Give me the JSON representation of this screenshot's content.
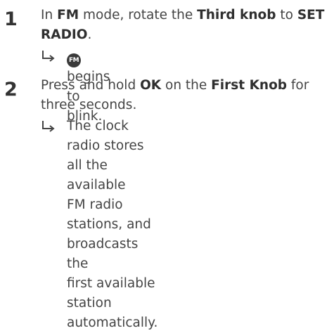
{
  "steps": [
    {
      "number": "1",
      "line1": {
        "a": "In ",
        "b": "FM",
        "c": " mode, rotate the ",
        "d": "Third knob",
        "e": " to ",
        "f": "SET"
      },
      "line2": {
        "a": "RADIO",
        "b": "."
      },
      "result": {
        "icon_name": "fm-icon",
        "icon_text": "FM",
        "text": "begins to blink."
      }
    },
    {
      "number": "2",
      "line1": {
        "a": "Press and hold ",
        "b": "OK",
        "c": " on the ",
        "d": "First Knob",
        "e": " for"
      },
      "line2": {
        "a": "three seconds."
      },
      "result": {
        "lines": [
          "The clock radio stores all the available",
          "FM radio stations, and broadcasts the",
          "first available station automatically."
        ]
      }
    }
  ]
}
